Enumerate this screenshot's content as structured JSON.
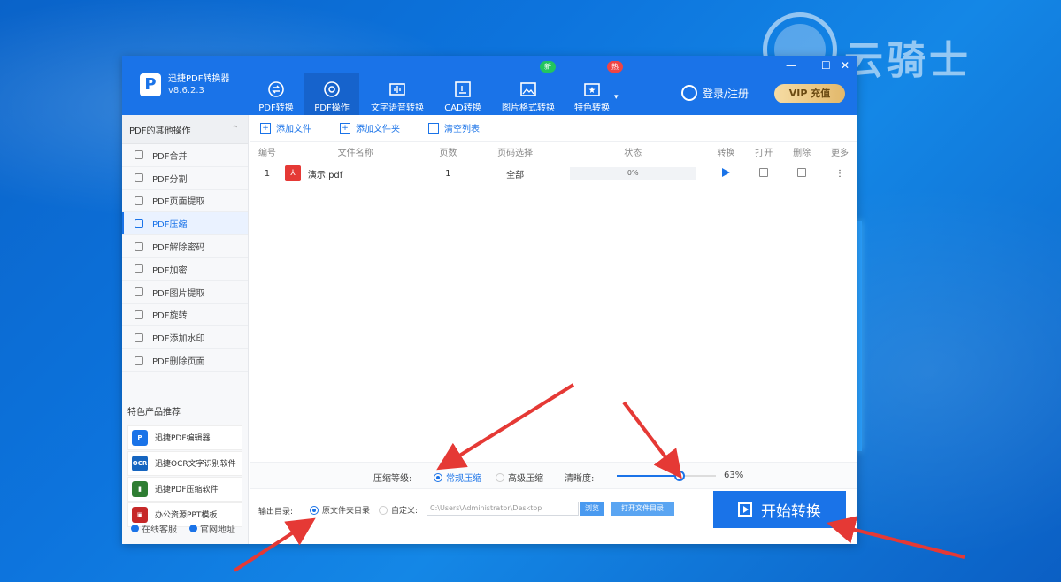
{
  "watermark": {
    "text": "云骑士"
  },
  "app": {
    "name": "迅捷PDF转换器",
    "version": "v8.6.2.3",
    "nav_tabs": [
      {
        "label": "PDF转换",
        "icon": "convert-icon"
      },
      {
        "label": "PDF操作",
        "icon": "pdf-op-icon",
        "active": true
      },
      {
        "label": "文字语音转换",
        "icon": "audio-icon"
      },
      {
        "label": "CAD转换",
        "icon": "cad-icon"
      },
      {
        "label": "图片格式转换",
        "icon": "image-icon"
      },
      {
        "label": "特色转换",
        "icon": "special-icon"
      }
    ],
    "badges": {
      "new": "新",
      "hot": "热"
    },
    "login_label": "登录/注册",
    "vip_label": "VIP 充值",
    "window_controls": {
      "min": "—",
      "max": "☐",
      "close": "✕"
    }
  },
  "sidebar": {
    "section_title": "PDF的其他操作",
    "items": [
      {
        "label": "PDF合并"
      },
      {
        "label": "PDF分割"
      },
      {
        "label": "PDF页面提取"
      },
      {
        "label": "PDF压缩",
        "active": true
      },
      {
        "label": "PDF解除密码"
      },
      {
        "label": "PDF加密"
      },
      {
        "label": "PDF图片提取"
      },
      {
        "label": "PDF旋转"
      },
      {
        "label": "PDF添加水印"
      },
      {
        "label": "PDF删除页面"
      }
    ],
    "products_title": "特色产品推荐",
    "products": [
      {
        "label": "迅捷PDF编辑器",
        "icon_text": "P",
        "color": "#1a73e8"
      },
      {
        "label": "迅捷OCR文字识别软件",
        "icon_text": "OCR",
        "color": "#1565c0"
      },
      {
        "label": "迅捷PDF压缩软件",
        "icon_text": "▮",
        "color": "#2e7d32"
      },
      {
        "label": "办公资源PPT模板",
        "icon_text": "▣",
        "color": "#c62828"
      }
    ],
    "footer": {
      "service": "在线客服",
      "website": "官网地址"
    }
  },
  "toolbar": {
    "add_file": "添加文件",
    "add_folder": "添加文件夹",
    "clear_list": "清空列表"
  },
  "table": {
    "headers": {
      "no": "编号",
      "name": "文件名称",
      "pages": "页数",
      "range": "页码选择",
      "status": "状态",
      "convert": "转换",
      "open": "打开",
      "delete": "删除",
      "more": "更多"
    },
    "rows": [
      {
        "no": "1",
        "name": "演示.pdf",
        "pages": "1",
        "range": "全部",
        "progress": "0%",
        "more": "⋮"
      }
    ]
  },
  "compress": {
    "level_label": "压缩等级:",
    "option_normal": "常规压缩",
    "option_advanced": "高级压缩",
    "clarity_label": "清晰度:",
    "clarity_value": "63%",
    "clarity_fraction": 0.63
  },
  "output": {
    "label": "输出目录:",
    "option_source": "原文件夹目录",
    "option_custom": "自定义:",
    "path": "C:\\Users\\Administrator\\Desktop",
    "browse": "浏览",
    "open_folder": "打开文件目录",
    "start": "开始转换"
  },
  "colors": {
    "accent": "#1a73e8",
    "annotation_arrow": "#e53935"
  }
}
